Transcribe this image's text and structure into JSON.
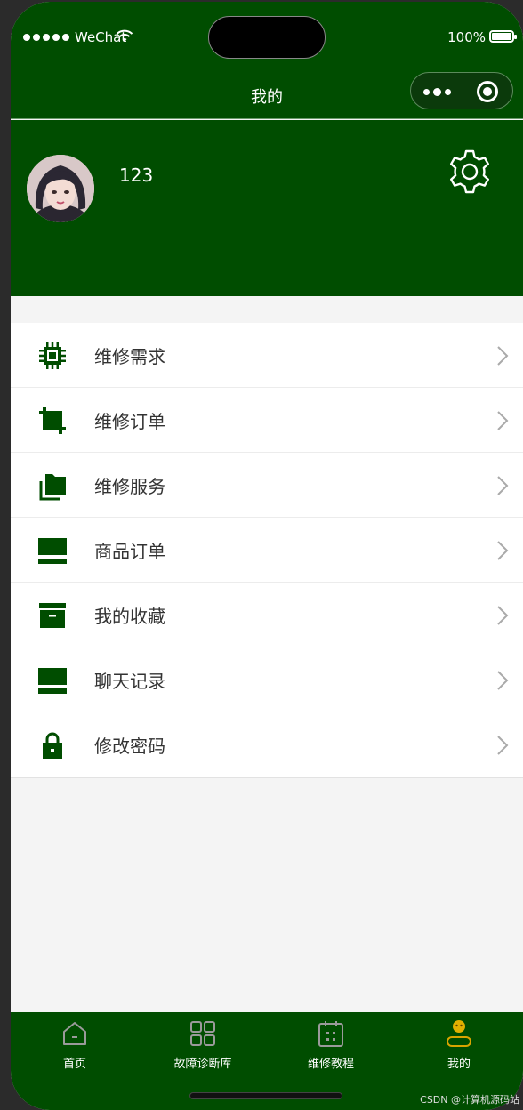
{
  "status_bar": {
    "carrier": "WeChat",
    "battery": "100%"
  },
  "nav": {
    "title": "我的"
  },
  "profile": {
    "username": "123"
  },
  "menu": {
    "items": [
      {
        "label": "维修需求",
        "icon": "chip-icon"
      },
      {
        "label": "维修订单",
        "icon": "crop-icon"
      },
      {
        "label": "维修服务",
        "icon": "folders-icon"
      },
      {
        "label": "商品订单",
        "icon": "monitor-icon"
      },
      {
        "label": "我的收藏",
        "icon": "archive-icon"
      },
      {
        "label": "聊天记录",
        "icon": "monitor-icon"
      },
      {
        "label": "修改密码",
        "icon": "lock-icon"
      }
    ]
  },
  "tabs": [
    {
      "label": "首页",
      "icon": "home-icon"
    },
    {
      "label": "故障诊断库",
      "icon": "grid-icon"
    },
    {
      "label": "维修教程",
      "icon": "calendar-icon"
    },
    {
      "label": "我的",
      "icon": "user-icon",
      "active": true
    }
  ],
  "watermark": "CSDN @计算机源码站",
  "colors": {
    "primary": "#004d00",
    "background": "#f4f4f4",
    "icon": "#004d00",
    "active_tab_icon": "#d9a400"
  }
}
